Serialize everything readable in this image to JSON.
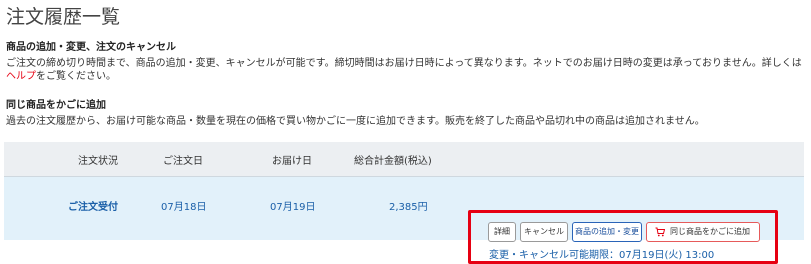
{
  "page": {
    "title": "注文履歴一覧"
  },
  "section_edit": {
    "heading": "商品の追加・変更、注文のキャンセル",
    "text_before_link": "ご注文の締め切り時間まで、商品の追加・変更、キャンセルが可能です。締切時間はお届け日時によって異なります。ネットでのお届け日時の変更は承っておりません。詳しくは",
    "link_label": "ヘルプ",
    "text_after_link": "をご覧ください。"
  },
  "section_reorder": {
    "heading": "同じ商品をかごに追加",
    "text": "過去の注文履歴から、お届け可能な商品・数量を現在の価格で買い物かごに一度に追加できます。販売を終了した商品や品切れ中の商品は追加されません。"
  },
  "table": {
    "headers": {
      "status": "注文状況",
      "order_date": "ご注文日",
      "delivery_date": "お届け日",
      "total": "総合計金額(税込)"
    },
    "rows": [
      {
        "status": "ご注文受付",
        "order_date": "07月18日",
        "delivery_date": "07月19日",
        "total": "2,385円",
        "actions": {
          "detail": "詳細",
          "cancel": "キャンセル",
          "add_change": "商品の追加・変更",
          "add_same_to_cart": "同じ商品をかごに追加"
        },
        "deadline": "変更・キャンセル可能期限：07月19日(火) 13:00"
      }
    ]
  },
  "colors": {
    "accent_red": "#e60012",
    "link_blue": "#1a5fa8",
    "row_bg": "#e2f1fa",
    "header_bg": "#eceff2"
  },
  "icons": {
    "cart": "cart-icon"
  }
}
